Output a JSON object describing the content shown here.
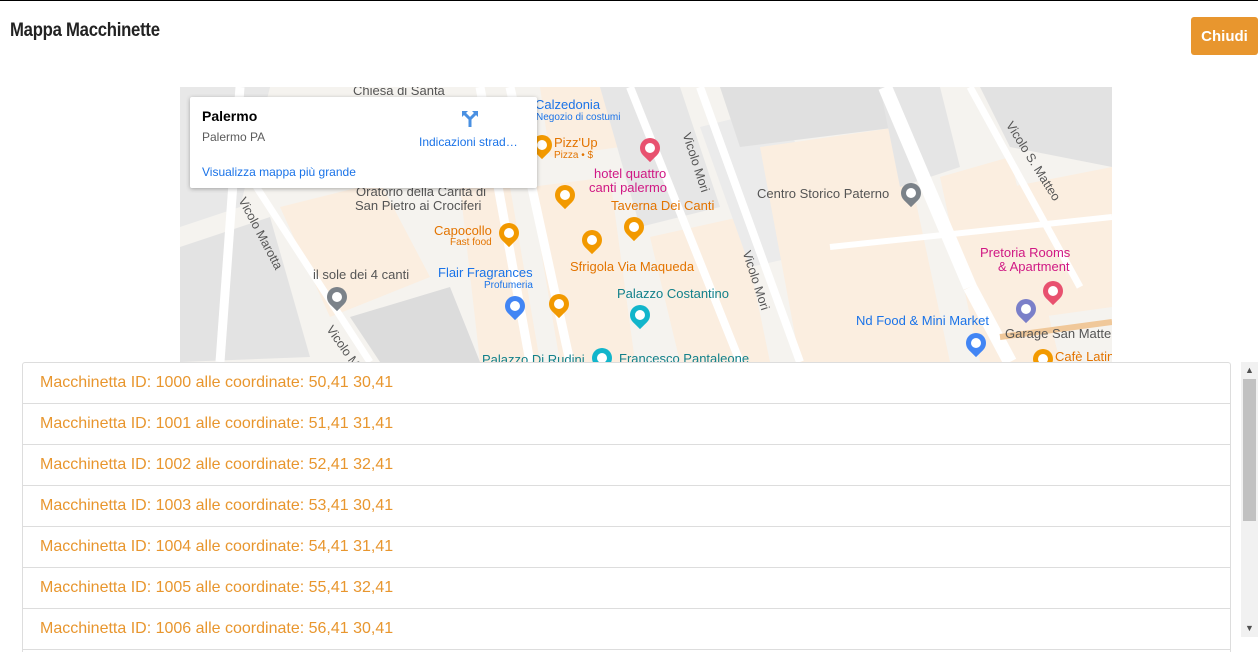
{
  "header": {
    "title": "Mappa Macchinette",
    "close_label": "Chiudi"
  },
  "colors": {
    "accent": "#e8962e",
    "link": "#1a73e8"
  },
  "map": {
    "info_card": {
      "title": "Palermo",
      "address": "Palermo PA",
      "directions_label": "Indicazioni strad…",
      "larger_map_link": "Visualizza mappa più grande"
    },
    "streets": [
      "Vicolo Marotta",
      "Vicolo Mori",
      "Vicolo Mori",
      "Vicolo S. Matteo",
      "Vicolo M"
    ],
    "places": {
      "chiesa": "Chiesa di Santa",
      "calzedonia": "Calzedonia",
      "calzedonia_sub": "Negozio di costumi",
      "pizzup": "Pizz'Up",
      "pizzup_sub": "Pizza • $",
      "hotel1": "hotel quattro",
      "hotel2": "canti palermo",
      "taverna": "Taverna Dei Canti",
      "oratorio1": "Oratorio della Carità di",
      "oratorio2": "San Pietro ai Crociferi",
      "capocollo": "Capocollo",
      "capocollo_sub": "Fast food",
      "sfrigola": "Sfrigola Via Maqueda",
      "sole": "il sole dei 4 canti",
      "flair": "Flair Fragrances",
      "flair_sub": "Profumeria",
      "costantino": "Palazzo Costantino",
      "rudini": "Palazzo Di Rudini",
      "pantaleone": "Francesco Pantaleone",
      "centro": "Centro Storico Paterno",
      "pretoria1": "Pretoria Rooms",
      "pretoria2": "& Apartment",
      "ndfood": "Nd Food & Mini Market",
      "garage": "Garage San Matte",
      "cafe": "Cafè Latin"
    }
  },
  "machines": [
    "Macchinetta ID: 1000 alle coordinate: 50,41 30,41",
    "Macchinetta ID: 1001 alle coordinate: 51,41 31,41",
    "Macchinetta ID: 1002 alle coordinate: 52,41 32,41",
    "Macchinetta ID: 1003 alle coordinate: 53,41 30,41",
    "Macchinetta ID: 1004 alle coordinate: 54,41 31,41",
    "Macchinetta ID: 1005 alle coordinate: 55,41 32,41",
    "Macchinetta ID: 1006 alle coordinate: 56,41 30,41"
  ]
}
